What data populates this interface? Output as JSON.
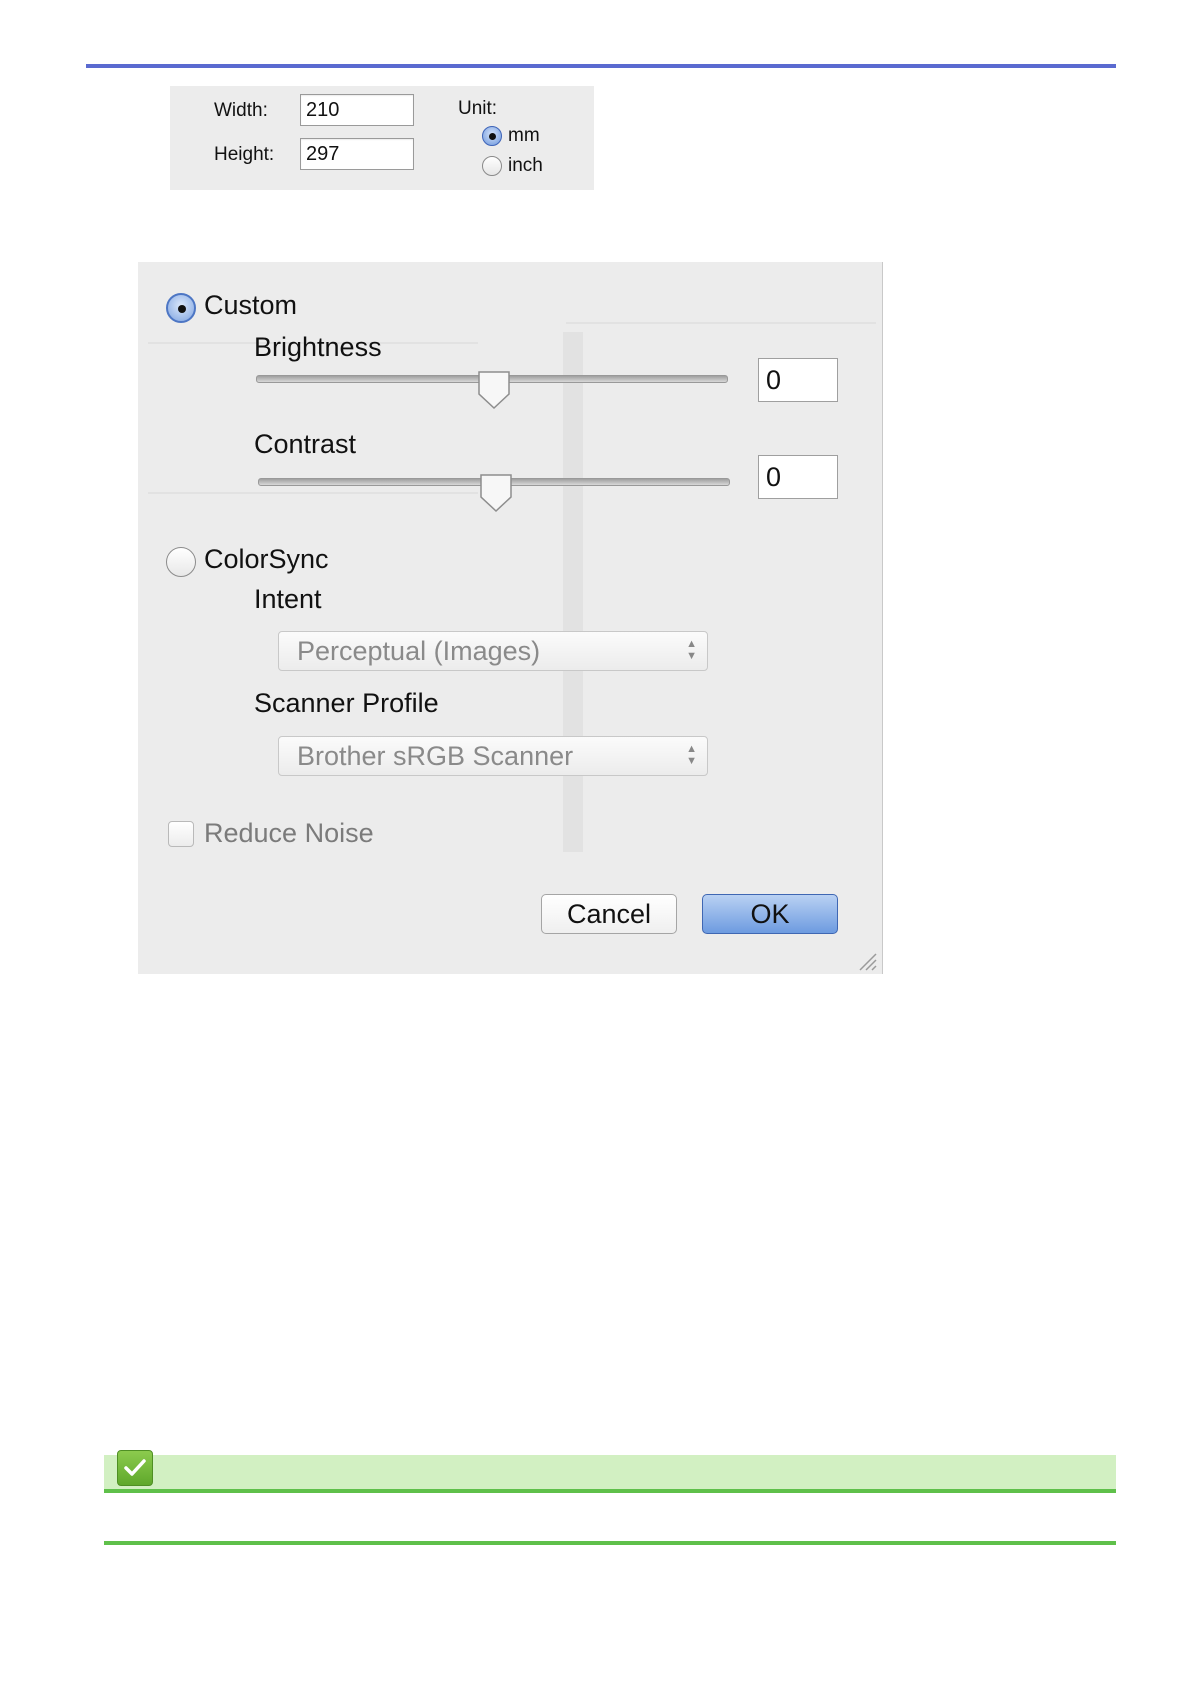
{
  "size_panel": {
    "width_label": "Width:",
    "width_value": "210",
    "height_label": "Height:",
    "height_value": "297",
    "unit_label": "Unit:",
    "unit_options": [
      "mm",
      "inch"
    ],
    "unit_selected": "mm"
  },
  "dialog": {
    "custom_label": "Custom",
    "brightness_label": "Brightness",
    "brightness_value": "0",
    "contrast_label": "Contrast",
    "contrast_value": "0",
    "colorsync_label": "ColorSync",
    "intent_label": "Intent",
    "intent_selected": "Perceptual (Images)",
    "scanner_profile_label": "Scanner Profile",
    "scanner_profile_selected": "Brother sRGB Scanner",
    "reduce_noise_label": "Reduce Noise",
    "cancel_label": "Cancel",
    "ok_label": "OK",
    "selected_mode": "Custom"
  },
  "colors": {
    "top_rule": "#5a6ad0",
    "note_bar": "#d2f0c2",
    "note_line": "#5fc04a",
    "ok_button": "#6d9be0"
  },
  "icons": {
    "note": "check-icon",
    "popup_arrows": "chevron-updown-icon",
    "resize": "resize-grip-icon"
  }
}
